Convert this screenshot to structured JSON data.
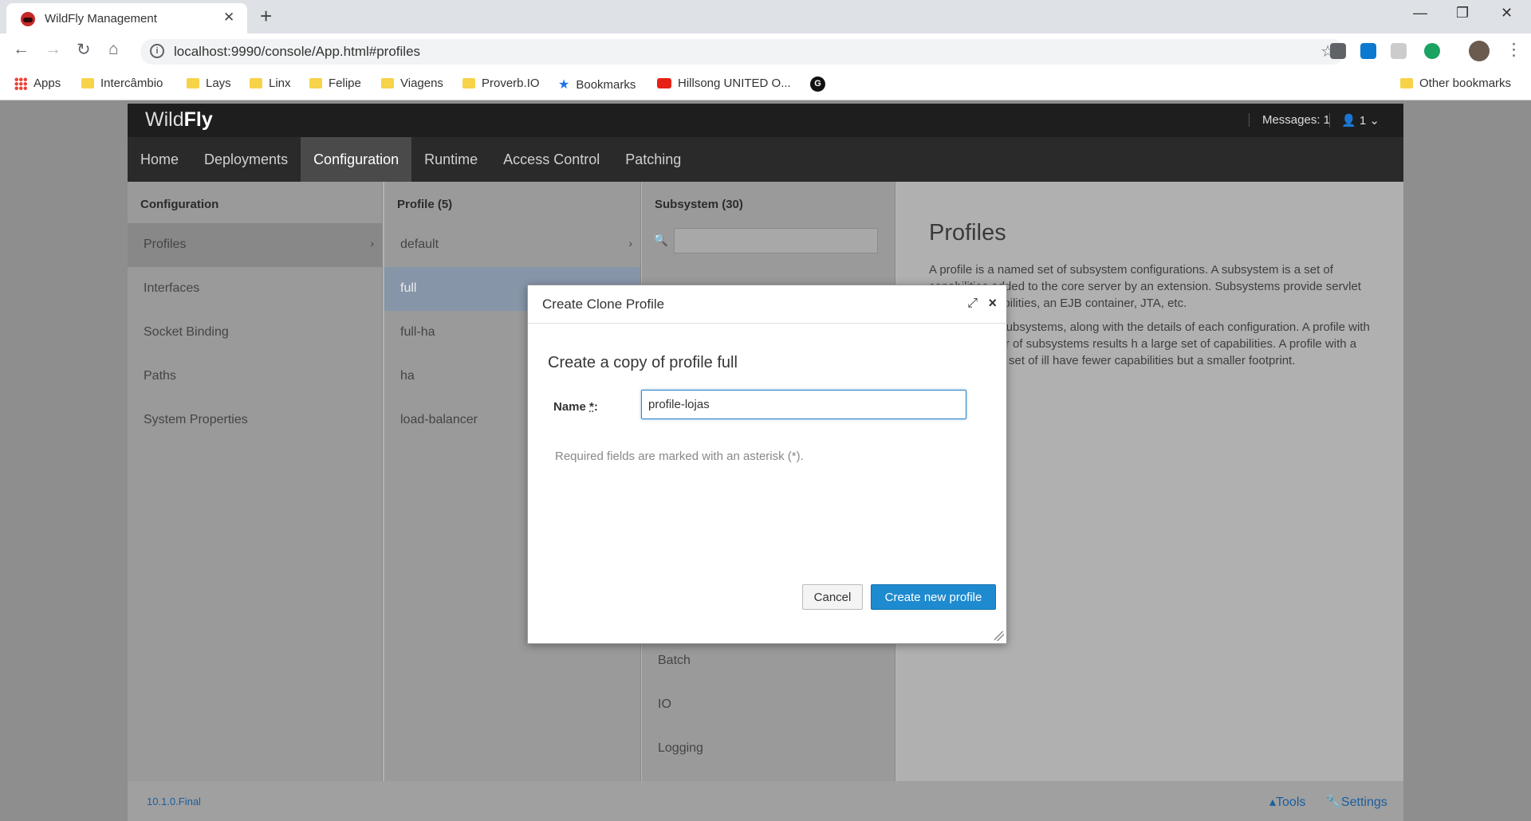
{
  "browser": {
    "tab_title": "WildFly Management",
    "url": "localhost:9990/console/App.html#profiles",
    "bookmarks": [
      "Apps",
      "Intercâmbio",
      "Lays",
      "Linx",
      "Felipe",
      "Viagens",
      "Proverb.IO",
      "Bookmarks",
      "Hillsong UNITED O...",
      "Other bookmarks"
    ]
  },
  "app": {
    "brand_light": "Wild",
    "brand_bold": "Fly",
    "messages": "Messages: 1",
    "user_count": "1",
    "nav": [
      "Home",
      "Deployments",
      "Configuration",
      "Runtime",
      "Access Control",
      "Patching"
    ],
    "active_nav": "Configuration",
    "col1": {
      "title": "Configuration",
      "items": [
        "Profiles",
        "Interfaces",
        "Socket Binding",
        "Paths",
        "System Properties"
      ]
    },
    "col2": {
      "title": "Profile (5)",
      "items": [
        "default",
        "full",
        "full-ha",
        "ha",
        "load-balancer"
      ]
    },
    "col3": {
      "title": "Subsystem (30)",
      "items": [
        "Batch",
        "IO",
        "Logging"
      ]
    },
    "info": {
      "title": "Profiles",
      "p1": "A profile is a named set of subsystem configurations. A subsystem is a set of capabilities added to the core server by an extension. Subsystems provide servlet handling capabilities, an EJB container, JTA, etc.",
      "p2": "named list of subsystems, along with the details of each configuration. A profile with a large number of subsystems results h a large set of capabilities. A profile with a small, focused set of ill have fewer capabilities but a smaller footprint."
    },
    "footer": {
      "version": "10.1.0.Final",
      "tools": "Tools",
      "settings": "Settings"
    }
  },
  "dialog": {
    "title": "Create Clone Profile",
    "subtitle": "Create a copy of profile full",
    "name_label": "Name",
    "name_required": "*",
    "name_value": "profile-lojas",
    "required_note": "Required fields are marked with an asterisk (*).",
    "cancel": "Cancel",
    "create": "Create new profile"
  }
}
